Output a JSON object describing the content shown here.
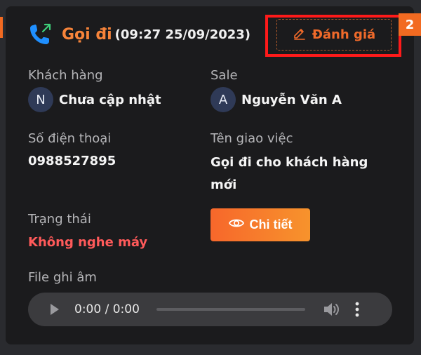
{
  "header": {
    "title": "Gọi đi",
    "time": "(09:27 25/09/2023)",
    "icon": "outgoing-call-icon"
  },
  "actions": {
    "rate_label": "Đánh giá",
    "rate_icon": "pencil-icon",
    "detail_label": "Chi tiết",
    "detail_icon": "eye-icon"
  },
  "step_badge": "2",
  "customer": {
    "label": "Khách hàng",
    "avatar_initial": "N",
    "name": "Chưa cập nhật"
  },
  "sale": {
    "label": "Sale",
    "avatar_initial": "A",
    "name": "Nguyễn Văn A"
  },
  "phone": {
    "label": "Số điện thoại",
    "value": "0988527895"
  },
  "task": {
    "label": "Tên giao việc",
    "value": "Gọi đi cho khách hàng mới"
  },
  "status": {
    "label": "Trạng thái",
    "value": "Không nghe máy",
    "color": "#ff5a5a"
  },
  "recording": {
    "label": "File ghi âm",
    "time": "0:00 / 0:00",
    "progress": 0
  },
  "colors": {
    "accent": "#f7843a",
    "highlight": "#ff1a1a",
    "card_bg": "#1b1b1d",
    "page_bg": "#2a2b2f"
  }
}
